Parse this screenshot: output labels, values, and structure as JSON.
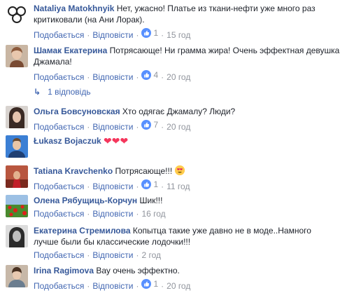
{
  "actions": {
    "like": "Подобається",
    "reply": "Відповісти",
    "dot": "·"
  },
  "comments": [
    {
      "author": "Nataliya Matokhnyik",
      "text": "Нет, ужасно! Платье из ткани-нефти уже много раз критиковали (на Ани Лорак).",
      "likes": "1",
      "time": "15 год",
      "avatar": "rings-pattern"
    },
    {
      "author": "Шамак Екатерина",
      "text": "Потрясающе! Ни грамма жира! Очень эффектная девушка Джамала!",
      "likes": "4",
      "time": "20 год",
      "avatar": "woman-portrait"
    },
    {
      "author": "Ольга Бовсуновская",
      "text": "Хто одягає Джамалу? Люди?",
      "likes": "7",
      "time": "20 год",
      "avatar": "woman-dark-hair"
    },
    {
      "author": "Łukasz Bojaczuk",
      "text": "",
      "likes": "",
      "time": "",
      "avatar": "man-blue"
    },
    {
      "author": "Tatiana Kravchenko",
      "text": "Потрясающе!!!",
      "likes": "1",
      "time": "11 год",
      "avatar": "red-scene"
    },
    {
      "author": "Олена Рябущиць-Корчун",
      "text": "Шик!!!",
      "likes": "",
      "time": "16 год",
      "avatar": "poppy-field"
    },
    {
      "author": "Екатерина Стремилова",
      "text": "Копытца такие уже давно не в моде..Намного лучше были бы классические лодочки!!!",
      "likes": "",
      "time": "2 год",
      "avatar": "woman-bw"
    },
    {
      "author": "Irina Ragimova",
      "text": "Вау очень эффектно.",
      "likes": "1",
      "time": "20 год",
      "avatar": "girl-photo"
    }
  ],
  "reply_toggle": "1 відповідь",
  "icons": {
    "like": "like-thumb-icon",
    "reply_arrow": "reply-arrow-icon",
    "heart": "heart-emoji-icon",
    "heart_eyes": "heart-eyes-emoji-icon"
  },
  "colors": {
    "link": "#365899",
    "action": "#4267b2",
    "meta": "#90949c",
    "like": "#5890ff"
  }
}
